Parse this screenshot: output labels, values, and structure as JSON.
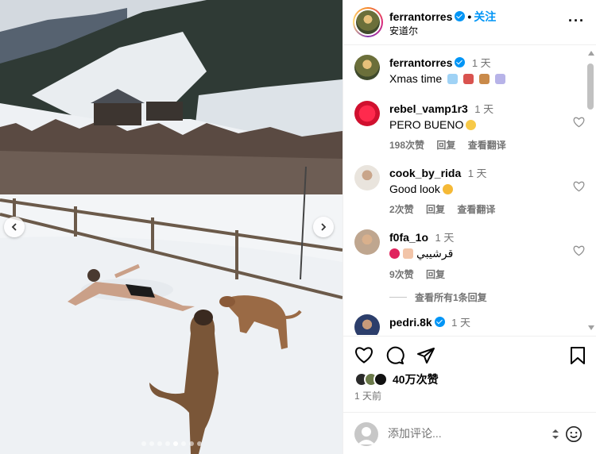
{
  "post": {
    "username": "ferrantorres",
    "follow_label": "关注",
    "separator": "•",
    "location": "安道尔",
    "more_label": "···",
    "carousel": {
      "slide_count": 8,
      "active_index": 4
    }
  },
  "caption": {
    "username": "ferrantorres",
    "time": "1 天",
    "text": "Xmas time",
    "emojis": [
      "snowflake",
      "sled",
      "reindeer",
      "snowman"
    ]
  },
  "comments": [
    {
      "username": "rebel_vamp1r3",
      "time": "1 天",
      "text": "PERO BUENO",
      "emoji": "heart-eyes",
      "likes": "198次赞",
      "reply_label": "回复",
      "translate_label": "查看翻译"
    },
    {
      "username": "cook_by_rida",
      "time": "1 天",
      "text": "Good look",
      "emoji": "clap",
      "likes": "2次赞",
      "reply_label": "回复",
      "translate_label": "查看翻译"
    },
    {
      "username": "f0fa_1o",
      "time": "1 天",
      "text": "قرشيبي",
      "emoji": "heart-hands",
      "likes": "9次赞",
      "reply_label": "回复"
    },
    {
      "username": "pedri.8k",
      "time": "1 天"
    }
  ],
  "view_replies": "查看所有1条回复",
  "actions": {
    "like_icon": "heart-icon",
    "comment_icon": "comment-icon",
    "share_icon": "share-icon",
    "save_icon": "bookmark-icon"
  },
  "likes_text": "40万次赞",
  "post_time": "1 天前",
  "comment_input": {
    "placeholder": "添加评论..."
  },
  "colors": {
    "accent": "#0095f6",
    "muted": "#737373",
    "border": "#efefef"
  }
}
